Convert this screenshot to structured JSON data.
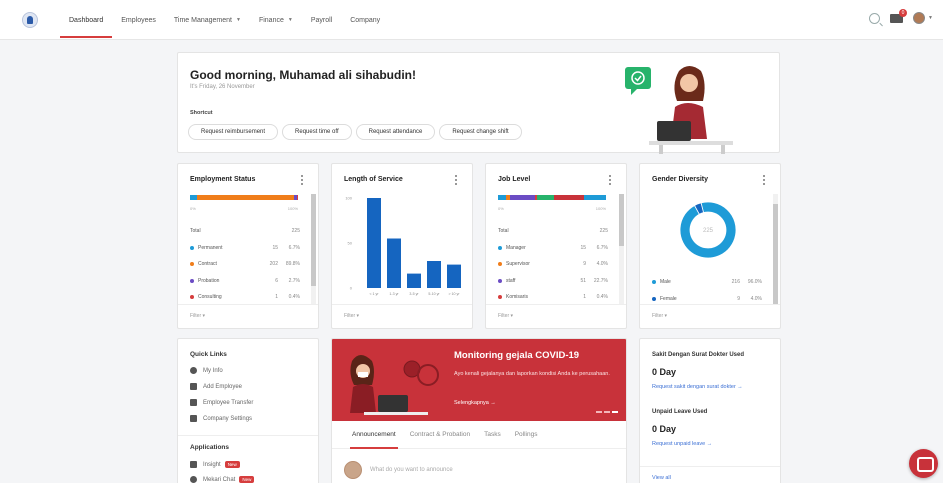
{
  "nav": {
    "items": [
      {
        "label": "Dashboard",
        "active": true,
        "dropdown": false
      },
      {
        "label": "Employees",
        "active": false,
        "dropdown": false
      },
      {
        "label": "Time Management",
        "active": false,
        "dropdown": true
      },
      {
        "label": "Finance",
        "active": false,
        "dropdown": true
      },
      {
        "label": "Payroll",
        "active": false,
        "dropdown": false
      },
      {
        "label": "Company",
        "active": false,
        "dropdown": false
      }
    ],
    "notification_count": "0",
    "accent": "#d63d3d"
  },
  "greeting": {
    "title": "Good morning, Muhamad ali sihabudin!",
    "date": "It's Friday, 26 November",
    "shortcut_label": "Shortcut",
    "shortcuts": [
      "Request reimbursement",
      "Request time off",
      "Request attendance",
      "Request change shift"
    ]
  },
  "employment_status": {
    "title": "Employment Status",
    "scale_min": "0%",
    "scale_max": "100%",
    "total_label": "Total",
    "total_value": "225",
    "rows": [
      {
        "label": "Permanent",
        "count": "15",
        "percent": "6.7%",
        "color": "#1e9bd7"
      },
      {
        "label": "Contract",
        "count": "202",
        "percent": "89.8%",
        "color": "#f07d1a"
      },
      {
        "label": "Probation",
        "count": "6",
        "percent": "2.7%",
        "color": "#6b4cc4"
      },
      {
        "label": "Consulting",
        "count": "1",
        "percent": "0.4%",
        "color": "#d63d3d"
      }
    ],
    "filter": "Filter"
  },
  "length_of_service": {
    "title": "Length of Service",
    "filter": "Filter"
  },
  "job_level": {
    "title": "Job Level",
    "scale_min": "0%",
    "scale_max": "100%",
    "total_label": "Total",
    "total_value": "225",
    "rows": [
      {
        "label": "Manager",
        "count": "15",
        "percent": "6.7%",
        "color": "#1e9bd7"
      },
      {
        "label": "Supervisor",
        "count": "9",
        "percent": "4.0%",
        "color": "#f07d1a"
      },
      {
        "label": "staff",
        "count": "51",
        "percent": "22.7%",
        "color": "#6b4cc4"
      },
      {
        "label": "Komisaris",
        "count": "1",
        "percent": "0.4%",
        "color": "#d63d3d"
      }
    ],
    "filter": "Filter"
  },
  "gender_diversity": {
    "title": "Gender Diversity",
    "center": "225",
    "rows": [
      {
        "label": "Male",
        "count": "216",
        "percent": "96.0%",
        "color": "#1e9bd7"
      },
      {
        "label": "Female",
        "count": "9",
        "percent": "4.0%",
        "color": "#1565c0"
      }
    ],
    "filter": "Filter"
  },
  "chart_data": [
    {
      "type": "bar",
      "title": "Length of Service",
      "categories": [
        "< 1 yr",
        "1-3 yr",
        "3-5 yr",
        "5-10 yr",
        "> 10 yr"
      ],
      "values": [
        100,
        55,
        16,
        30,
        26
      ],
      "ylim": [
        0,
        100
      ],
      "yticks": [
        "100",
        "50",
        "0"
      ],
      "color": "#1565c0"
    },
    {
      "type": "pie",
      "title": "Gender Diversity",
      "categories": [
        "Male",
        "Female"
      ],
      "values": [
        216,
        9
      ],
      "colors": [
        "#1e9bd7",
        "#1565c0"
      ]
    }
  ],
  "quick_links": {
    "title": "Quick Links",
    "items": [
      "My Info",
      "Add Employee",
      "Employee Transfer",
      "Company Settings"
    ],
    "apps_title": "Applications",
    "apps": [
      {
        "label": "Insight",
        "badge": "New"
      },
      {
        "label": "Mekari Chat",
        "badge": "New"
      }
    ]
  },
  "covid": {
    "title": "Monitoring gejala COVID-19",
    "description": "Ayo kenali gejalanya dan laporkan kondisi Anda ke perusahaan.",
    "link": "Selengkapnya →",
    "tabs": [
      "Announcement",
      "Contract & Probation",
      "Tasks",
      "Pollings"
    ],
    "announce_placeholder": "What do you want to announce"
  },
  "leave": {
    "sick_title": "Sakit Dengan Surat Dokter Used",
    "sick_value": "0 Day",
    "sick_link": "Request sakit dengan surat dokter →",
    "unpaid_title": "Unpaid Leave Used",
    "unpaid_value": "0 Day",
    "unpaid_link": "Request unpaid leave →",
    "view_all": "View all"
  }
}
